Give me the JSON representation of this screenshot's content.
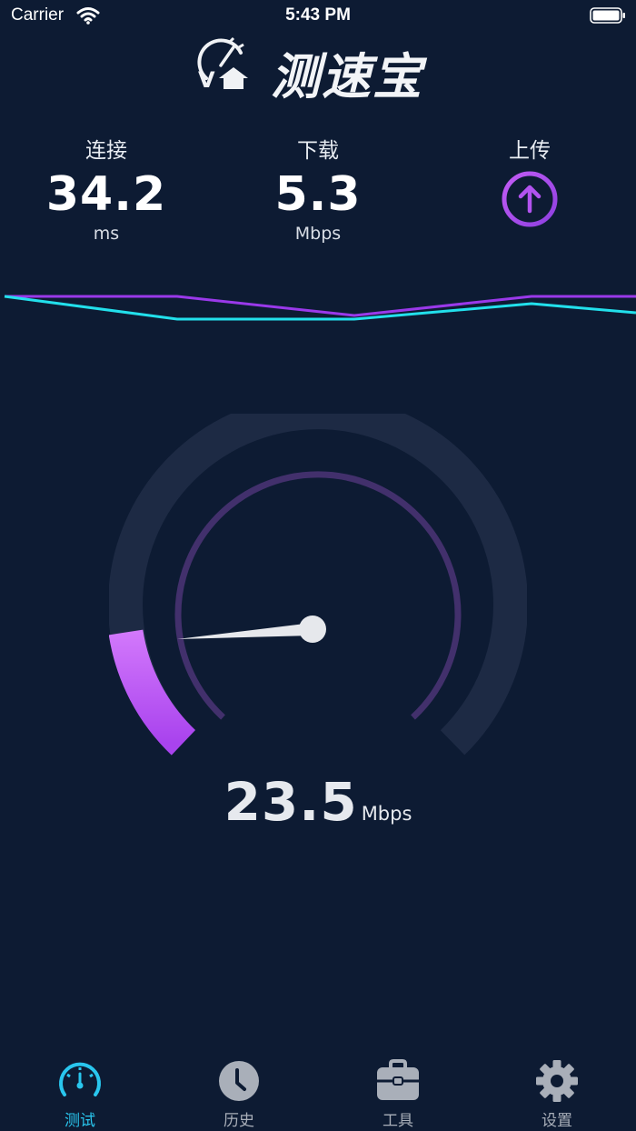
{
  "status_bar": {
    "carrier": "Carrier",
    "time": "5:43 PM"
  },
  "app": {
    "title": "测速宝"
  },
  "metrics": {
    "connect": {
      "label": "连接",
      "value": "34.2",
      "unit": "ms"
    },
    "download": {
      "label": "下载",
      "value": "5.3",
      "unit": "Mbps"
    },
    "upload": {
      "label": "上传",
      "icon": "arrow-up-circle-icon"
    }
  },
  "gauge": {
    "value": "23.5",
    "unit": "Mbps",
    "fill_fraction": 0.1
  },
  "colors": {
    "background": "#0d1b33",
    "accent_purple": "#c160f0",
    "accent_cyan": "#22e0ec",
    "tab_active": "#29c6ee"
  },
  "tabs": [
    {
      "label": "测试",
      "icon": "speedometer-icon",
      "active": true
    },
    {
      "label": "历史",
      "icon": "clock-icon",
      "active": false
    },
    {
      "label": "工具",
      "icon": "toolbox-icon",
      "active": false
    },
    {
      "label": "设置",
      "icon": "gear-icon",
      "active": false
    }
  ]
}
